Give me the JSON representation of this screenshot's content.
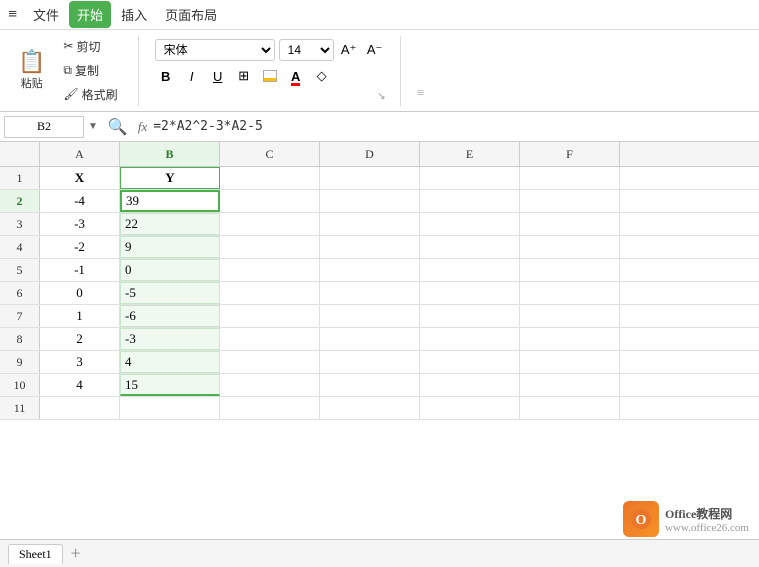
{
  "menubar": {
    "icon": "≡",
    "items": [
      "文件",
      "开始",
      "插入",
      "页面布局"
    ],
    "active_item": "开始"
  },
  "ribbon": {
    "paste_label": "粘贴",
    "cut_label": "剪切",
    "copy_label": "复制",
    "format_brush_label": "格式刷",
    "font_name": "宋体",
    "font_size": "14",
    "bold": "B",
    "italic": "I",
    "underline": "U",
    "border_btn": "⊞",
    "fill_btn": "⬜",
    "font_color_label": "A",
    "eraser_label": "◇",
    "size_increase": "A⁺",
    "size_decrease": "A⁻"
  },
  "formula_bar": {
    "cell_ref": "B2",
    "formula": "=2*A2^2-3*A2-5"
  },
  "spreadsheet": {
    "columns": [
      "A",
      "B",
      "C",
      "D",
      "E",
      "F"
    ],
    "active_cell": "B2",
    "rows": [
      {
        "row_num": 1,
        "cells": [
          "X",
          "Y",
          "",
          "",
          "",
          ""
        ]
      },
      {
        "row_num": 2,
        "cells": [
          "-4",
          "39",
          "",
          "",
          "",
          ""
        ]
      },
      {
        "row_num": 3,
        "cells": [
          "-3",
          "22",
          "",
          "",
          "",
          ""
        ]
      },
      {
        "row_num": 4,
        "cells": [
          "-2",
          "9",
          "",
          "",
          "",
          ""
        ]
      },
      {
        "row_num": 5,
        "cells": [
          "-1",
          "0",
          "",
          "",
          "",
          ""
        ]
      },
      {
        "row_num": 6,
        "cells": [
          "0",
          "-5",
          "",
          "",
          "",
          ""
        ]
      },
      {
        "row_num": 7,
        "cells": [
          "1",
          "-6",
          "",
          "",
          "",
          ""
        ]
      },
      {
        "row_num": 8,
        "cells": [
          "2",
          "-3",
          "",
          "",
          "",
          ""
        ]
      },
      {
        "row_num": 9,
        "cells": [
          "3",
          "4",
          "",
          "",
          "",
          ""
        ]
      },
      {
        "row_num": 10,
        "cells": [
          "4",
          "15",
          "",
          "",
          "",
          ""
        ]
      }
    ]
  },
  "watermark": {
    "icon_text": "O",
    "site1": "Office教程网",
    "site2": "www.office26.com"
  },
  "sheet_tabs": [
    "Sheet1"
  ]
}
